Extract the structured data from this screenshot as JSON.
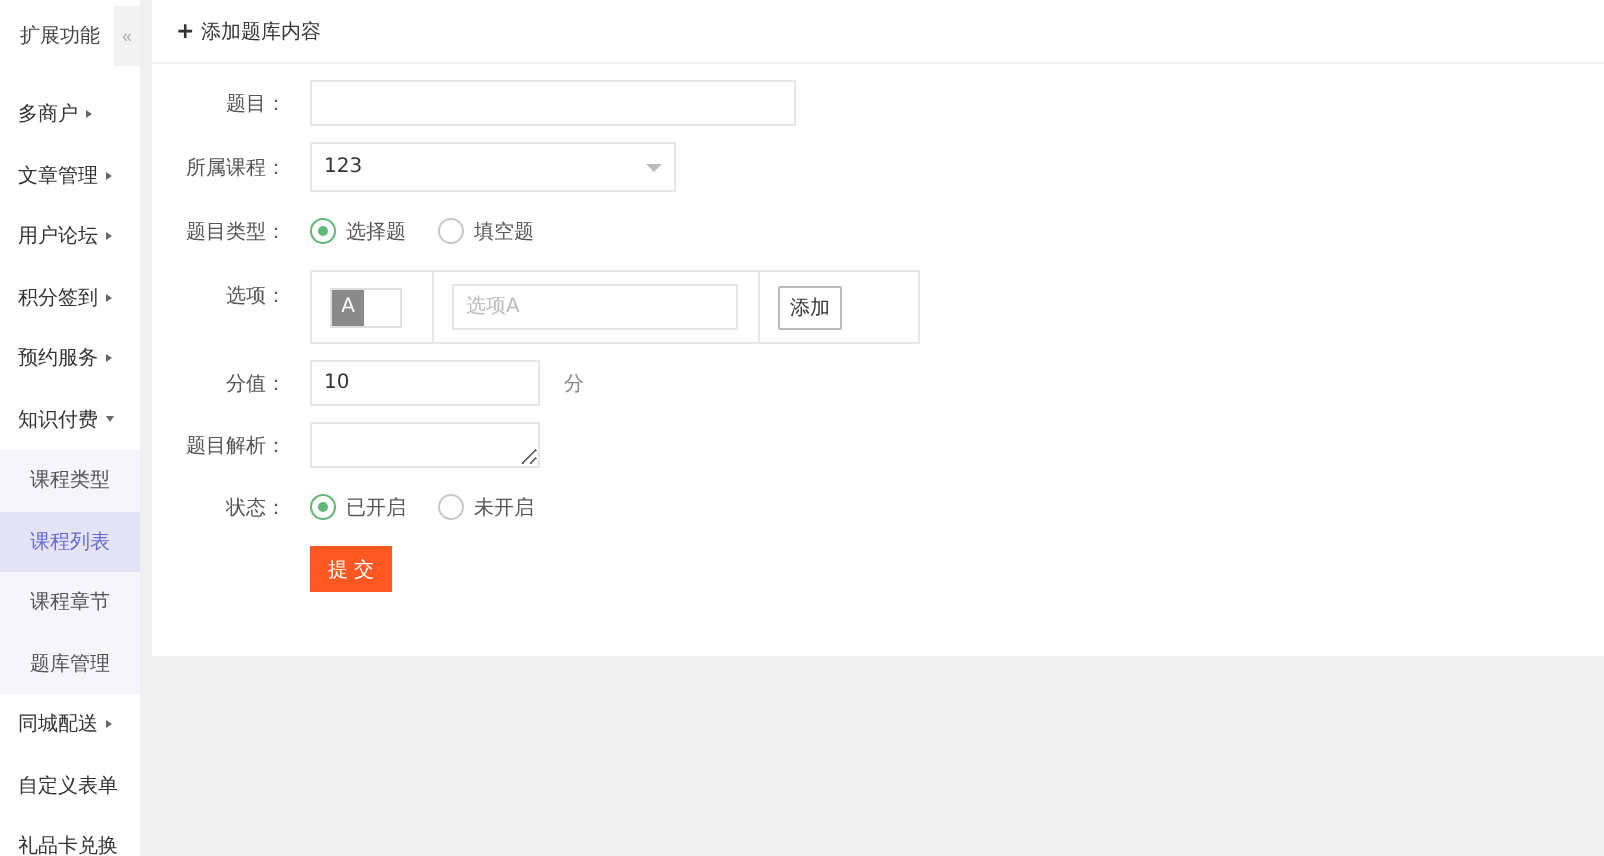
{
  "sidebar": {
    "title": "扩展功能",
    "collapse": "«",
    "items": [
      {
        "label": "多商户",
        "kind": "group",
        "expanded": false
      },
      {
        "label": "文章管理",
        "kind": "group",
        "expanded": false
      },
      {
        "label": "用户论坛",
        "kind": "group",
        "expanded": false
      },
      {
        "label": "积分签到",
        "kind": "group",
        "expanded": false
      },
      {
        "label": "预约服务",
        "kind": "group",
        "expanded": false
      },
      {
        "label": "知识付费",
        "kind": "group",
        "expanded": true,
        "children": [
          {
            "label": "课程类型",
            "selected": false
          },
          {
            "label": "课程列表",
            "selected": true
          },
          {
            "label": "课程章节",
            "selected": false
          },
          {
            "label": "题库管理",
            "selected": false
          }
        ]
      },
      {
        "label": "同城配送",
        "kind": "group",
        "expanded": false
      },
      {
        "label": "自定义表单",
        "kind": "link"
      },
      {
        "label": "礼品卡兑换",
        "kind": "link"
      }
    ]
  },
  "panel": {
    "title": "添加题库内容",
    "icon": "+"
  },
  "form": {
    "fields": [
      {
        "kind": "text",
        "label": "题目："
      },
      {
        "kind": "select",
        "label": "所属课程：",
        "value": "123"
      },
      {
        "kind": "radio",
        "label": "题目类型：",
        "options": [
          {
            "label": "选择题",
            "selected": true
          },
          {
            "label": "填空题",
            "selected": false
          }
        ]
      },
      {
        "kind": "options",
        "label": "选项：",
        "letter": "A",
        "placeholder": "选项A",
        "button": "添加"
      },
      {
        "kind": "number",
        "label": "分值：",
        "value": "10",
        "unit": "分"
      },
      {
        "kind": "textarea",
        "label": "题目解析："
      },
      {
        "kind": "radio",
        "label": "状态：",
        "options": [
          {
            "label": "已开启",
            "selected": true
          },
          {
            "label": "未开启",
            "selected": false
          }
        ]
      }
    ],
    "submit": "提 交"
  }
}
